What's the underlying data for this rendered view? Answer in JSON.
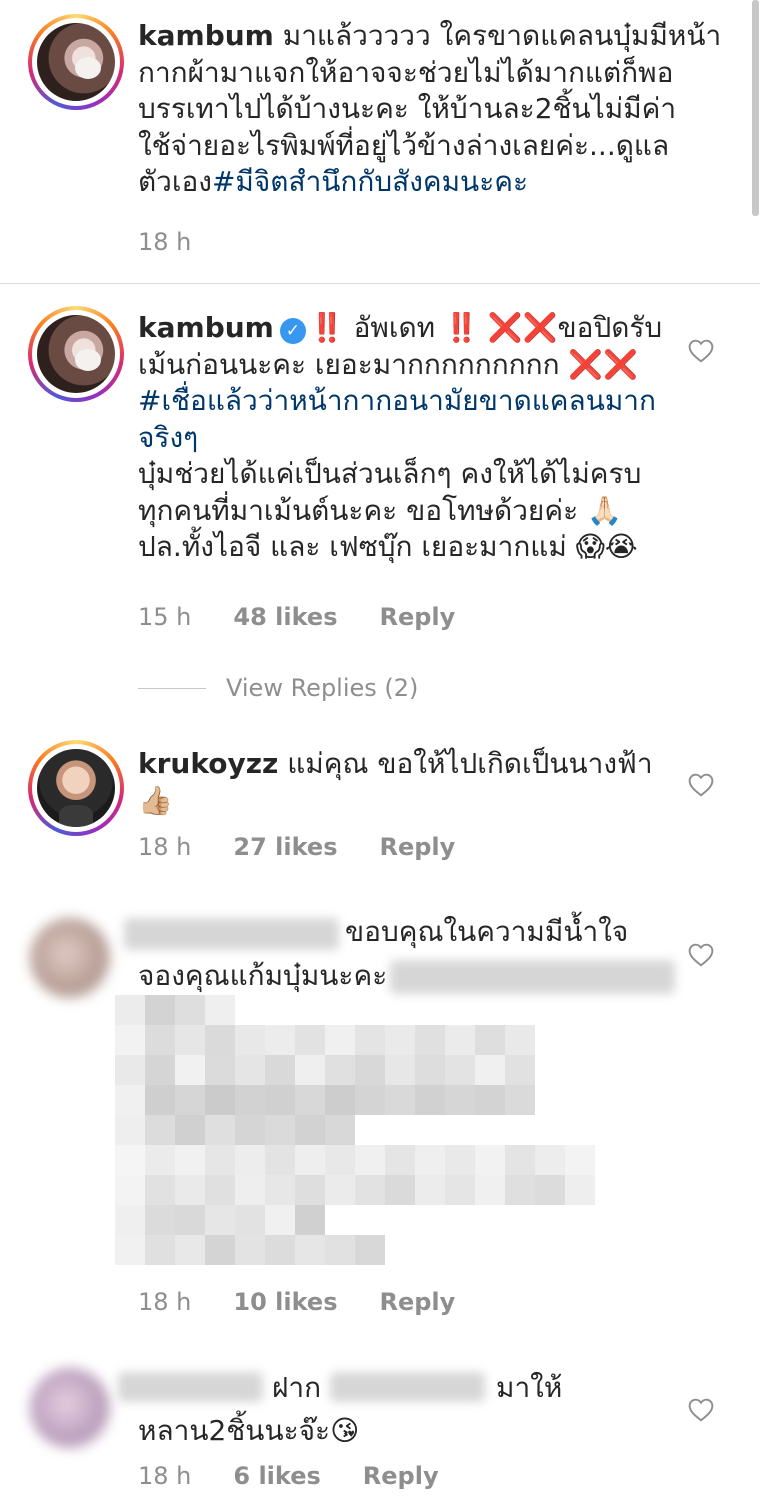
{
  "comments": [
    {
      "username": "kambum",
      "text_lines": [
        " มาแล้ววววว ใครขาดแคลนบุ๋มมีหน้า",
        "กากผ้ามาแจกให้อาจจะช่วยไม่ได้มากแต่ก็พอ",
        "บรรเทาไปได้บ้างนะคะ ให้บ้านละ2ชิ้นไม่มีค่า",
        "ใช้จ่ายอะไรพิมพ์ที่อยู่ไว้ข้างล่างเลยค่ะ...ดูแล",
        "ตัวเอง"
      ],
      "hashtag": "#มีจิตสำนึกกับสังคมนะคะ",
      "time": "18 h"
    },
    {
      "username": "kambum",
      "verified": true,
      "line1": "‼️ อัพเดท ‼️ ❌❌ขอปิดรับ",
      "line2": "เม้นก่อนนะคะ เยอะมากกกกกกกกก ❌❌",
      "hashtag_line1": "#เชื่อแล้วว่าหน้ากากอนามัยขาดแคลนมาก",
      "hashtag_line2": "จริงๆ",
      "line5": "บุ๋มช่วยได้แค่เป็นส่วนเล็กๆ คงให้ได้ไม่ครบ",
      "line6": "ทุกคนที่มาเม้นต์นะคะ ขอโทษด้วยค่ะ 🙏🏻",
      "line7": "ปล.ทั้งไอจี และ เฟซบุ๊ก เยอะมากแม่ 😱😭",
      "time": "15 h",
      "likes": "48 likes",
      "reply": "Reply",
      "view_replies": "View Replies (2)"
    },
    {
      "username": "krukoyzz",
      "text": " แม่คุณ ขอให้ไปเกิดเป็นนางฟ้า",
      "line2": "👍🏼",
      "time": "18 h",
      "likes": "27 likes",
      "reply": "Reply"
    },
    {
      "line1": "ขอบคุณในความมีน้ำใจ",
      "line2": "จองคุณแก้มบุ๋มนะคะ",
      "time": "18 h",
      "likes": "10 likes",
      "reply": "Reply"
    },
    {
      "line1_a": "ฝาก",
      "line1_b": "มาให้",
      "line2": "หลาน2ชิ้นนะจ๊ะ😘",
      "time": "18 h",
      "likes": "6 likes",
      "reply": "Reply"
    }
  ],
  "colors": {
    "text": "#262626",
    "meta": "#8e8e8e",
    "hashtag": "#00376b",
    "verified": "#3897f0",
    "divider": "#dbdbdb"
  },
  "icons": [
    "heart-icon",
    "verified-badge-icon"
  ]
}
